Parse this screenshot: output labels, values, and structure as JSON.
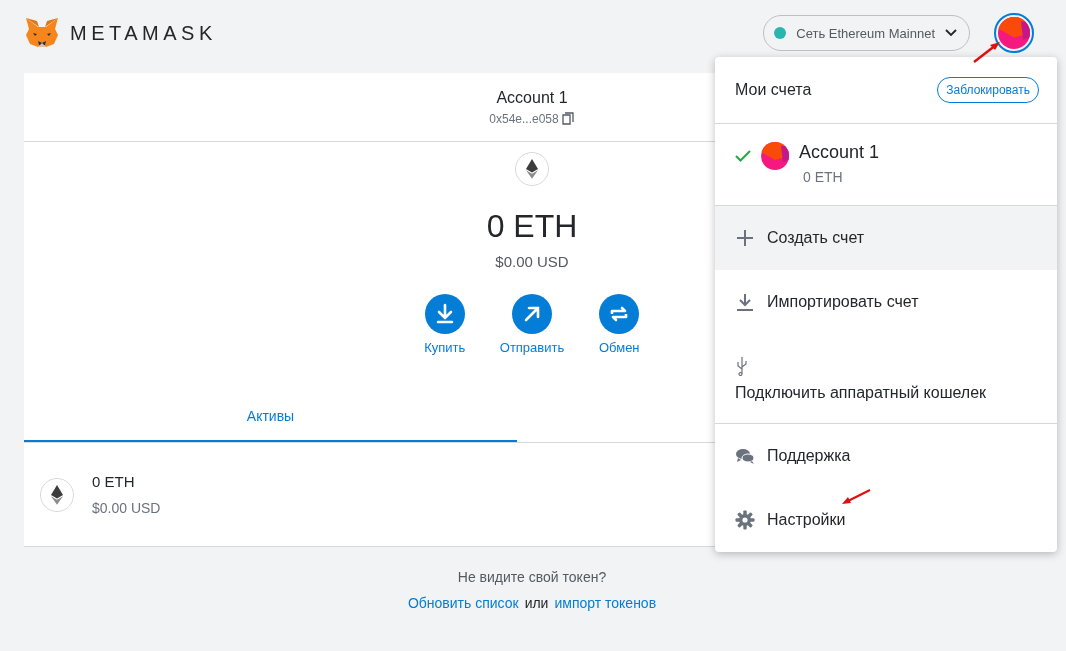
{
  "header": {
    "logo_text": "METAMASK",
    "network": {
      "label": "Сеть Ethereum Mainnet",
      "color": "#29b6af"
    }
  },
  "account": {
    "name": "Account 1",
    "address": "0x54e...e058"
  },
  "balance": {
    "amount": "0 ETH",
    "fiat": "$0.00 USD"
  },
  "actions": [
    {
      "kind": "buy",
      "label": "Купить"
    },
    {
      "kind": "send",
      "label": "Отправить"
    },
    {
      "kind": "swap",
      "label": "Обмен"
    }
  ],
  "tabs": [
    {
      "label": "Активы",
      "selected": true
    }
  ],
  "assets": [
    {
      "amount": "0 ETH",
      "fiat": "$0.00 USD"
    }
  ],
  "footer": {
    "question": "Не видите свой токен?",
    "refresh_link": "Обновить список",
    "conjunction": "или",
    "import_link": "импорт токенов"
  },
  "account_menu": {
    "title": "Мои счета",
    "lock_button": "Заблокировать",
    "accounts": [
      {
        "name": "Account 1",
        "balance": "0 ETH",
        "selected": true
      }
    ],
    "items": [
      {
        "kind": "create",
        "label": "Создать счет",
        "highlighted": true
      },
      {
        "kind": "import",
        "label": "Импортировать счет",
        "highlighted": false
      },
      {
        "kind": "hardware",
        "label": "Подключить аппаратный кошелек",
        "highlighted": false
      },
      {
        "kind": "support",
        "label": "Поддержка",
        "highlighted": false
      },
      {
        "kind": "settings",
        "label": "Настройки",
        "highlighted": false
      }
    ]
  }
}
